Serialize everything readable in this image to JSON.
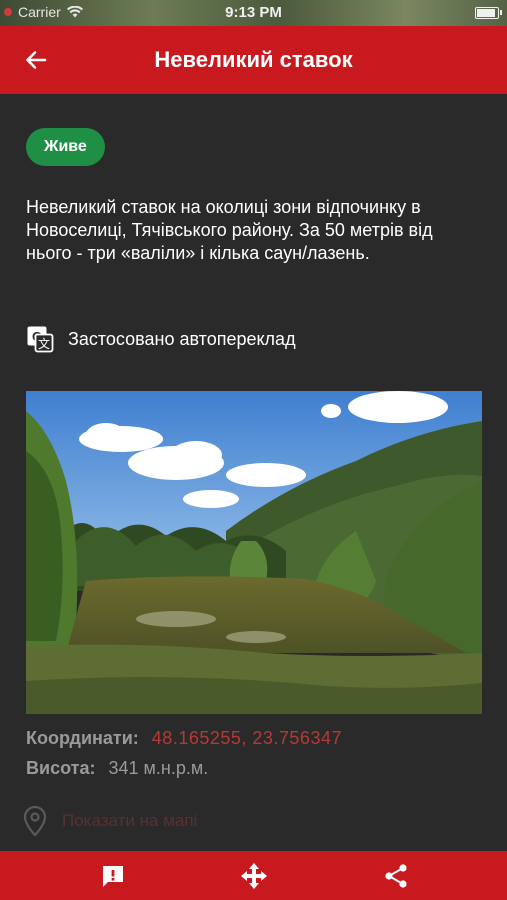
{
  "status_bar": {
    "carrier": "Carrier",
    "time": "9:13 PM"
  },
  "header": {
    "title": "Невеликий ставок",
    "back_icon": "arrow-left-icon"
  },
  "badge": {
    "label": "Живе",
    "color": "#1e8f45"
  },
  "description": "Невеликий ставок на околиці зони відпочинку в Новоселиці, Тячівського району. За 50 метрів від нього - три «валіли» і кілька саун/лазень.",
  "translation": {
    "icon": "google-translate-icon",
    "label": "Застосовано автопереклад"
  },
  "info": {
    "coords_label": "Координати:",
    "coords_value": "48.165255, 23.756347",
    "height_label": "Висота:",
    "height_value": "341 м.н.р.м."
  },
  "map_link": {
    "icon": "map-pin-icon",
    "label": "Показати на мапі"
  },
  "bottom_bar": {
    "report_icon": "report-icon",
    "move_icon": "move-icon",
    "share_icon": "share-icon"
  },
  "colors": {
    "accent": "#c8191e",
    "background": "#2a2a2a",
    "coords": "#b43a36"
  }
}
